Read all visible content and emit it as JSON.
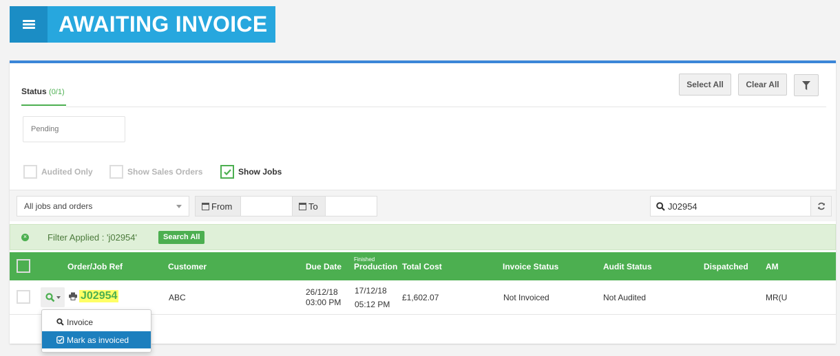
{
  "header": {
    "title": "AWAITING INVOICE",
    "menu_icon": "hamburger-icon"
  },
  "status_tab": {
    "label": "Status",
    "count": "(0/1)"
  },
  "buttons": {
    "select_all": "Select All",
    "clear_all": "Clear All",
    "filter_icon": "funnel-icon"
  },
  "status_options": [
    {
      "label": "Pending",
      "selected": false
    }
  ],
  "checkboxes": [
    {
      "label": "Audited Only",
      "checked": false
    },
    {
      "label": "Show Sales Orders",
      "checked": false
    },
    {
      "label": "Show Jobs",
      "checked": true
    }
  ],
  "toolbar": {
    "type_select": "All jobs and orders",
    "from_label": "From",
    "to_label": "To",
    "from_value": "",
    "to_value": "",
    "search_value": "J02954"
  },
  "filter": {
    "text": "Filter Applied : 'j02954'",
    "search_all": "Search All"
  },
  "table": {
    "columns": {
      "ref": "Order/Job Ref",
      "customer": "Customer",
      "due": "Due Date",
      "production_top": "Finished",
      "production": "Production",
      "cost": "Total Cost",
      "invoice": "Invoice Status",
      "audit": "Audit Status",
      "dispatched": "Dispatched",
      "am": "AM"
    },
    "rows": [
      {
        "ref": "J02954",
        "customer": "ABC",
        "due_date": "26/12/18",
        "due_time": "03:00 PM",
        "prod_date": "17/12/18",
        "prod_time": "05:12 PM",
        "cost": "£1,602.07",
        "invoice_status": "Not Invoiced",
        "audit_status": "Not Audited",
        "dispatched": "",
        "am": "MR(U"
      }
    ]
  },
  "row_menu": [
    {
      "label": "Invoice",
      "icon": "search-icon"
    },
    {
      "label": "Mark as invoiced",
      "icon": "check-square-icon"
    }
  ],
  "colors": {
    "accent_green": "#4caf50",
    "header_blue": "#27a7de",
    "menu_blue": "#1b8dc5",
    "highlight": "#ffff66"
  }
}
